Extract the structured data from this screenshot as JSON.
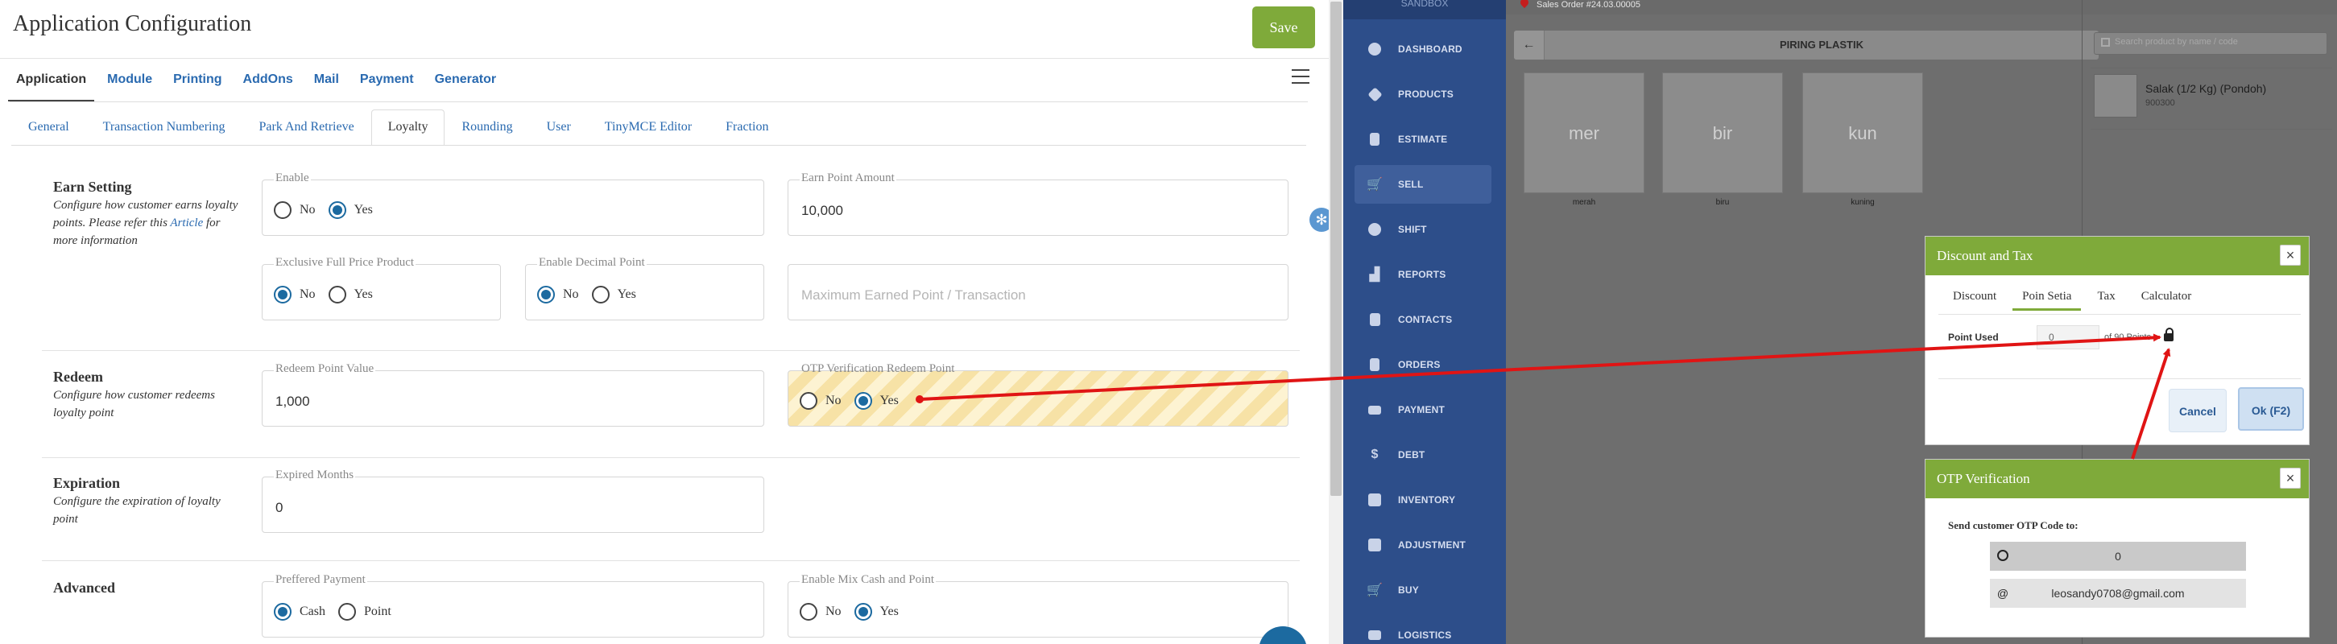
{
  "config": {
    "title": "Application Configuration",
    "save_label": "Save",
    "main_tabs": [
      "Application",
      "Module",
      "Printing",
      "AddOns",
      "Mail",
      "Payment",
      "Generator"
    ],
    "sub_tabs": [
      "General",
      "Transaction Numbering",
      "Park And Retrieve",
      "Loyalty",
      "Rounding",
      "User",
      "TinyMCE Editor",
      "Fraction"
    ],
    "sections": {
      "earn": {
        "title": "Earn Setting",
        "desc_prefix": "Configure how customer earns loyalty points. Please refer this",
        "desc_link": "Article",
        "desc_suffix": "for more information",
        "enable": {
          "legend": "Enable",
          "no": "No",
          "yes": "Yes",
          "selected": "Yes"
        },
        "earn_point_amount": {
          "legend": "Earn Point Amount",
          "value": "10,000"
        },
        "exclusive_full_price": {
          "legend": "Exclusive Full Price Product",
          "no": "No",
          "yes": "Yes",
          "selected": "No"
        },
        "enable_decimal_point": {
          "legend": "Enable Decimal Point",
          "no": "No",
          "yes": "Yes",
          "selected": "No"
        },
        "max_earned_point": {
          "placeholder": "Maximum Earned Point / Transaction"
        }
      },
      "redeem": {
        "title": "Redeem",
        "desc": "Configure how customer redeems loyalty point",
        "redeem_point_value": {
          "legend": "Redeem Point Value",
          "value": "1,000"
        },
        "otp_verification": {
          "legend": "OTP Verification Redeem Point",
          "no": "No",
          "yes": "Yes",
          "selected": "Yes"
        }
      },
      "expiration": {
        "title": "Expiration",
        "desc": "Configure the expiration of loyalty point",
        "expired_months": {
          "legend": "Expired Months",
          "value": "0"
        }
      },
      "advanced": {
        "title": "Advanced",
        "preffered_payment": {
          "legend": "Preffered Payment",
          "cash": "Cash",
          "point": "Point",
          "selected": "Cash"
        },
        "mix_cash_point": {
          "legend": "Enable Mix Cash and Point",
          "no": "No",
          "yes": "Yes",
          "selected": "Yes"
        }
      }
    }
  },
  "pos": {
    "nav_header": "SANDBOX",
    "nav": [
      {
        "label": "DASHBOARD",
        "icon": "pie-chart-icon"
      },
      {
        "label": "PRODUCTS",
        "icon": "tag-icon"
      },
      {
        "label": "ESTIMATE",
        "icon": "clipboard-icon"
      },
      {
        "label": "SELL",
        "icon": "cart-icon",
        "active": true
      },
      {
        "label": "SHIFT",
        "icon": "user-clock-icon"
      },
      {
        "label": "REPORTS",
        "icon": "chart-area-icon"
      },
      {
        "label": "CONTACTS",
        "icon": "address-book-icon"
      },
      {
        "label": "ORDERS",
        "icon": "file-icon"
      },
      {
        "label": "PAYMENT",
        "icon": "money-bill-icon"
      },
      {
        "label": "DEBT",
        "icon": "dollar-icon"
      },
      {
        "label": "INVENTORY",
        "icon": "archive-icon"
      },
      {
        "label": "ADJUSTMENT",
        "icon": "dolly-icon"
      },
      {
        "label": "BUY",
        "icon": "cart-plus-icon"
      },
      {
        "label": "LOGISTICS",
        "icon": "truck-icon"
      }
    ],
    "sales_order": "Sales Order #24.03.00005",
    "back_glyph": "←",
    "category_title": "PIRING PLASTIK",
    "tiles": [
      {
        "abbr": "mer",
        "label": "merah"
      },
      {
        "abbr": "bir",
        "label": "biru"
      },
      {
        "abbr": "kun",
        "label": "kuning"
      }
    ],
    "search_placeholder": "Search product by name / code",
    "cart_item": {
      "name": "Salak (1/2 Kg) (Pondoh)",
      "code": "900300"
    }
  },
  "discount_modal": {
    "title": "Discount and Tax",
    "close_glyph": "×",
    "tabs": [
      "Discount",
      "Poin Setia",
      "Tax",
      "Calculator"
    ],
    "active_tab": "Poin Setia",
    "point_used_label": "Point Used",
    "point_used_value": "0",
    "of_points": "of 90 Points",
    "cancel_label": "Cancel",
    "ok_label": "Ok (F2)"
  },
  "otp_modal": {
    "title": "OTP Verification",
    "close_glyph": "×",
    "send_label": "Send customer OTP Code to:",
    "phone_value": "0",
    "email_icon": "@",
    "email_value": "leosandy0708@gmail.com"
  },
  "colors": {
    "accent_green": "#7faa3a",
    "link_blue": "#2a6ab0",
    "radio_blue": "#1c6aa0",
    "nav_blue": "#2d4e8a",
    "annotation_red": "#e01414"
  }
}
